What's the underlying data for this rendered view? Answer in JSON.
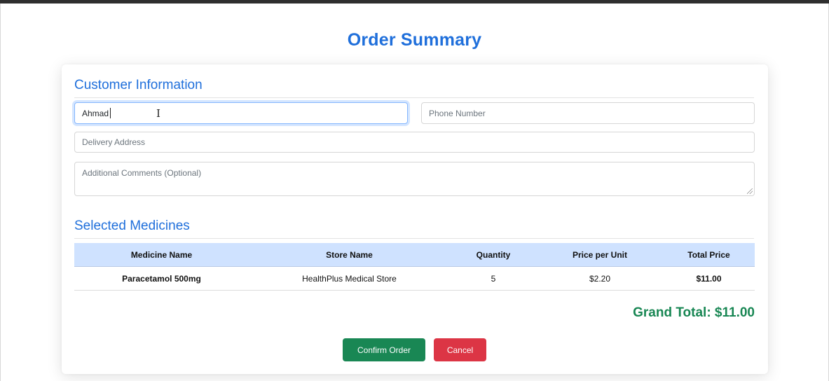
{
  "page": {
    "title": "Order Summary"
  },
  "customer": {
    "section_title": "Customer Information",
    "name": {
      "value": "Ahmad",
      "placeholder": ""
    },
    "phone": {
      "value": "",
      "placeholder": "Phone Number"
    },
    "address": {
      "value": "",
      "placeholder": "Delivery Address"
    },
    "comments": {
      "value": "",
      "placeholder": "Additional Comments (Optional)"
    }
  },
  "medicines": {
    "section_title": "Selected Medicines",
    "columns": [
      "Medicine Name",
      "Store Name",
      "Quantity",
      "Price per Unit",
      "Total Price"
    ],
    "rows": [
      [
        "Paracetamol 500mg",
        "HealthPlus Medical Store",
        "5",
        "$2.20",
        "$11.00"
      ]
    ]
  },
  "summary": {
    "grand_total": "Grand Total: $11.00"
  },
  "actions": {
    "confirm_label": "Confirm Order",
    "cancel_label": "Cancel"
  },
  "colors": {
    "accent": "#1f6fdb",
    "table_header": "#cfe2ff",
    "success": "#198754",
    "danger": "#dc3545"
  },
  "icons": {
    "cursor": "text-cursor-icon"
  }
}
